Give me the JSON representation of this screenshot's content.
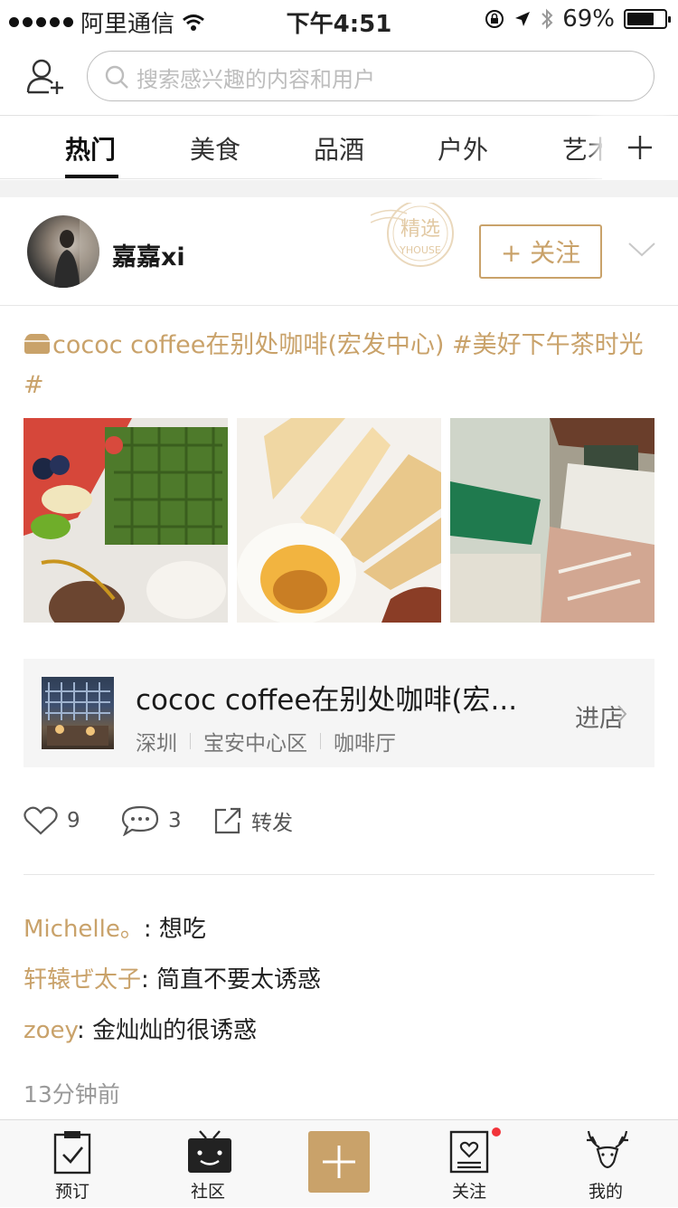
{
  "status_bar": {
    "carrier": "阿里通信",
    "time": "下午4:51",
    "battery": "69%",
    "battery_level": 0.69
  },
  "search": {
    "placeholder": "搜索感兴趣的内容和用户"
  },
  "tabs": [
    {
      "label": "热门",
      "active": true
    },
    {
      "label": "美食",
      "active": false
    },
    {
      "label": "品酒",
      "active": false
    },
    {
      "label": "户外",
      "active": false
    },
    {
      "label": "艺术",
      "active": false
    }
  ],
  "post": {
    "username": "嘉嘉xi",
    "badge": "精选",
    "badge_sub": "YHOUSE",
    "follow_label": "+ 关注",
    "text": "cococ coffee在别处咖啡(宏发中心) #美好下午茶时光#",
    "shop": {
      "name": "cococ coffee在别处咖啡(宏...",
      "city": "深圳",
      "district": "宝安中心区",
      "category": "咖啡厅",
      "enter_label": "进店"
    },
    "likes": "9",
    "comments_count": "3",
    "share_label": "转发",
    "comments": [
      {
        "user": "Michelle。",
        "text": ": 想吃"
      },
      {
        "user": "轩辕ぜ太子",
        "text": ": 简直不要太诱惑"
      },
      {
        "user": "zoey",
        "text": ": 金灿灿的很诱惑"
      }
    ],
    "time_ago": "13分钟前"
  },
  "bottom_nav": [
    {
      "label": "预订",
      "icon": "clipboard-check-icon"
    },
    {
      "label": "社区",
      "icon": "tv-face-icon"
    },
    {
      "label": "",
      "icon": "plus-icon"
    },
    {
      "label": "关注",
      "icon": "heart-doc-icon"
    },
    {
      "label": "我的",
      "icon": "deer-icon"
    }
  ],
  "colors": {
    "accent": "#c9a26a",
    "badge_dot": "#f2343a"
  }
}
